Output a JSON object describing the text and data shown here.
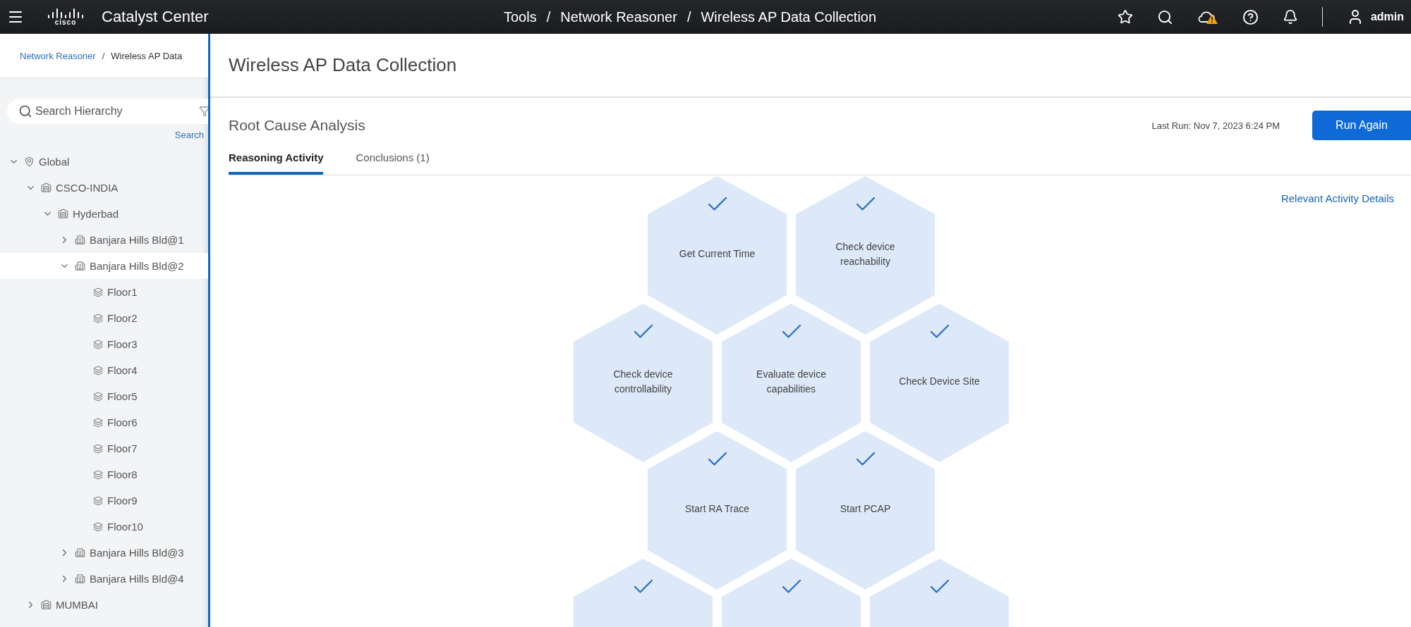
{
  "header": {
    "logo_text": "cisco",
    "app_name": "Catalyst Center",
    "breadcrumb": [
      "Tools",
      "Network Reasoner",
      "Wireless AP Data Collection"
    ],
    "separator": "/",
    "user": "admin",
    "alert": true
  },
  "sidebar": {
    "breadcrumb": {
      "link": "Network Reasoner",
      "separator": "/",
      "current": "Wireless AP Data"
    },
    "search": {
      "placeholder": "Search Hierarchy",
      "action": "Search"
    },
    "tree": [
      {
        "label": "Global",
        "kind": "global",
        "expanded": true,
        "selected": false,
        "children": [
          {
            "label": "CSCO-INDIA",
            "kind": "area",
            "expanded": true,
            "selected": false,
            "children": [
              {
                "label": "Hyderbad",
                "kind": "area",
                "expanded": true,
                "selected": false,
                "children": [
                  {
                    "label": "Banjara Hills Bld@1",
                    "kind": "building",
                    "expanded": false,
                    "selected": false
                  },
                  {
                    "label": "Banjara Hills Bld@2",
                    "kind": "building",
                    "expanded": true,
                    "selected": true,
                    "children": [
                      {
                        "label": "Floor1",
                        "kind": "floor",
                        "selected": false
                      },
                      {
                        "label": "Floor2",
                        "kind": "floor",
                        "selected": false
                      },
                      {
                        "label": "Floor3",
                        "kind": "floor",
                        "selected": false
                      },
                      {
                        "label": "Floor4",
                        "kind": "floor",
                        "selected": false
                      },
                      {
                        "label": "Floor5",
                        "kind": "floor",
                        "selected": false
                      },
                      {
                        "label": "Floor6",
                        "kind": "floor",
                        "selected": false
                      },
                      {
                        "label": "Floor7",
                        "kind": "floor",
                        "selected": false
                      },
                      {
                        "label": "Floor8",
                        "kind": "floor",
                        "selected": false
                      },
                      {
                        "label": "Floor9",
                        "kind": "floor",
                        "selected": false
                      },
                      {
                        "label": "Floor10",
                        "kind": "floor",
                        "selected": false
                      }
                    ]
                  },
                  {
                    "label": "Banjara Hills Bld@3",
                    "kind": "building",
                    "expanded": false,
                    "selected": false
                  },
                  {
                    "label": "Banjara Hills Bld@4",
                    "kind": "building",
                    "expanded": false,
                    "selected": false
                  }
                ]
              }
            ]
          },
          {
            "label": "MUMBAI",
            "kind": "area",
            "expanded": false,
            "selected": false
          }
        ]
      }
    ]
  },
  "main": {
    "title": "Wireless AP Data Collection",
    "section_title": "Root Cause Analysis",
    "last_run": "Last Run: Nov 7, 2023 6:24 PM",
    "run_button": "Run Again",
    "tabs": [
      {
        "label": "Reasoning Activity",
        "selected": true
      },
      {
        "label": "Conclusions (1)",
        "selected": false
      }
    ],
    "details_link": "Relevant Activity Details",
    "activity_rows": [
      [
        {
          "label": "Get Current Time",
          "done": true
        },
        {
          "label": "Check device reachability",
          "done": true
        }
      ],
      [
        {
          "label": "Check device controllability",
          "done": true
        },
        {
          "label": "Evaluate device capabilities",
          "done": true
        },
        {
          "label": "Check Device Site",
          "done": true
        }
      ],
      [
        {
          "label": "Start RA Trace",
          "done": true
        },
        {
          "label": "Start PCAP",
          "done": true
        }
      ],
      [
        {
          "done": true
        },
        {
          "done": true
        },
        {
          "done": true
        }
      ]
    ]
  }
}
